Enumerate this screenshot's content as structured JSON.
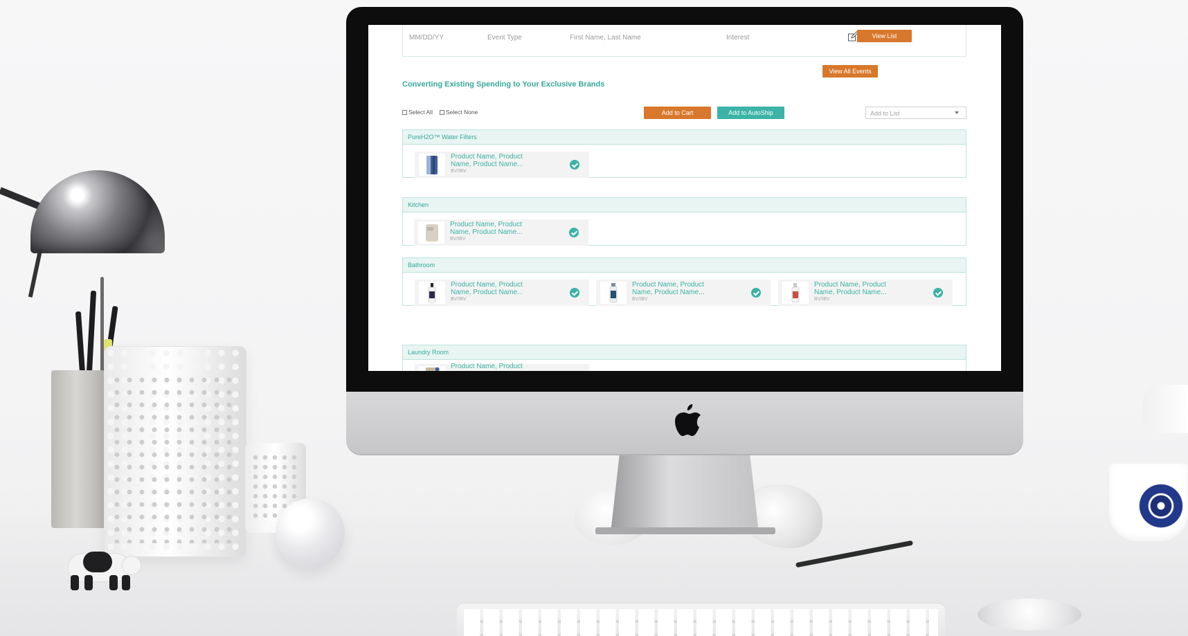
{
  "event_row": {
    "date": "MM/DD/YY",
    "event_type": "Event Type",
    "name": "First Name, Last Name",
    "interest": "Interest",
    "view_list": "View List"
  },
  "view_all_events": "View All Events",
  "section_title": "Converting Existing Spending to Your Exclusive Brands",
  "select_all": "Select All",
  "select_none": "Select None",
  "add_to_cart": "Add to Cart",
  "add_to_autoship": "Add to AutoShip",
  "add_to_list": "Add to List",
  "categories": [
    {
      "name": "PureH2O™ Water Filters",
      "products": [
        {
          "name": "Product Name, Product Name, Product Name...",
          "bv": "BV/IBV"
        }
      ]
    },
    {
      "name": "Kitchen",
      "products": [
        {
          "name": "Product Name, Product Name, Product Name...",
          "bv": "BV/IBV"
        }
      ]
    },
    {
      "name": "Bathroom",
      "products": [
        {
          "name": "Product Name, Product Name, Product Name...",
          "bv": "BV/IBV"
        },
        {
          "name": "Product Name, Product Name, Product Name...",
          "bv": "BV/IBV"
        },
        {
          "name": "Product Name, Product Name, Product Name...",
          "bv": "BV/IBV"
        }
      ]
    },
    {
      "name": "Laundry Room",
      "products": [
        {
          "name": "Product Name, Product",
          "bv": ""
        }
      ]
    }
  ],
  "colors": {
    "accent_teal": "#3bb3a6",
    "accent_orange": "#d8782c",
    "category_header_bg": "#e8f5f3"
  },
  "icons": [
    "edit-icon",
    "check-circle-icon",
    "chevron-down-icon",
    "apple-logo-icon"
  ]
}
